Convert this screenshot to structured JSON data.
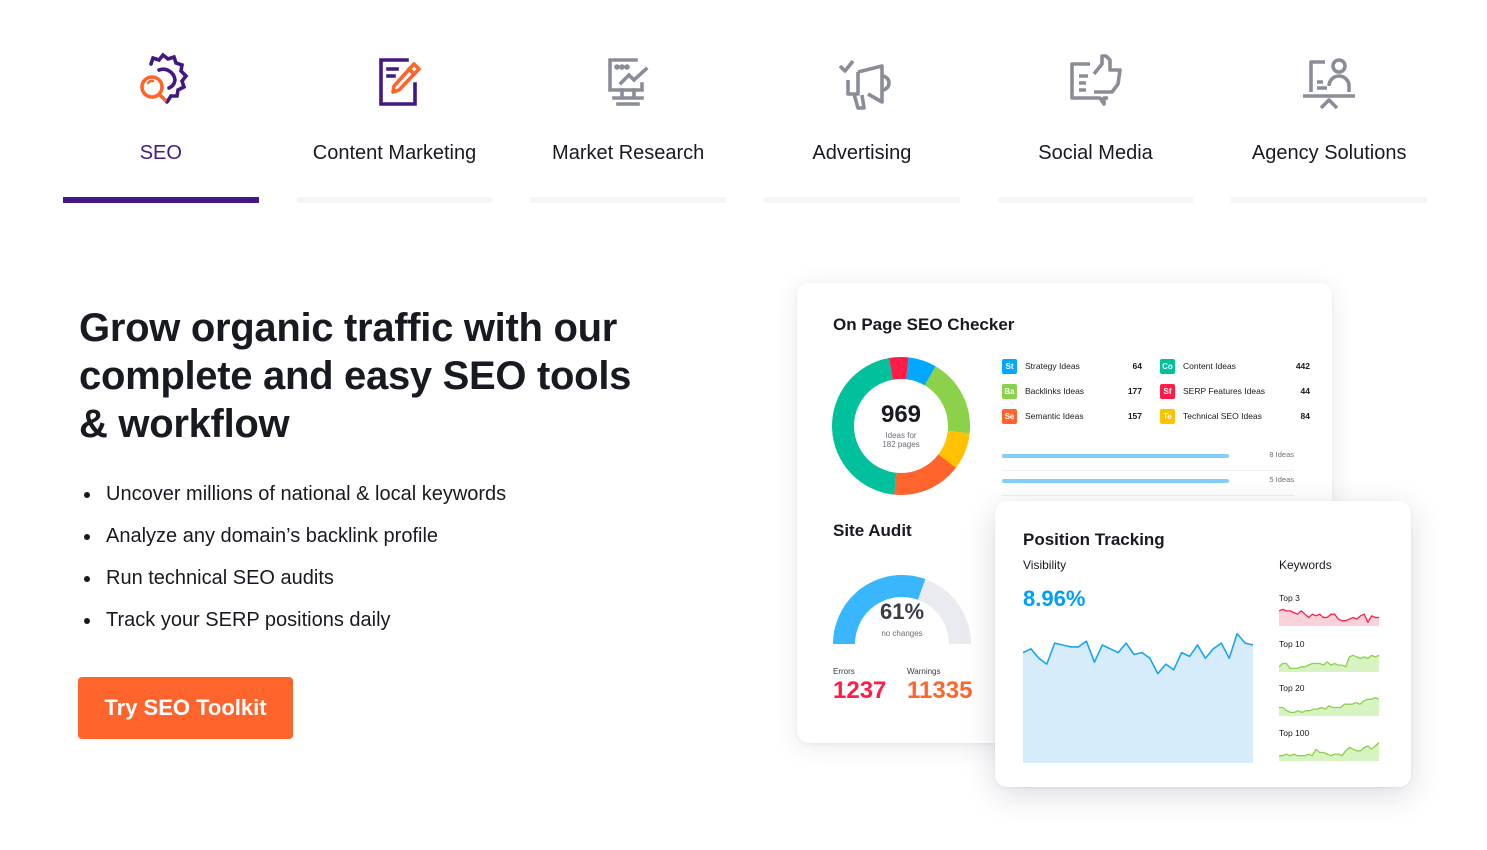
{
  "tabs": [
    {
      "label": "SEO",
      "icon": "seo-gear-magnifier-icon",
      "active": true
    },
    {
      "label": "Content Marketing",
      "icon": "document-pencil-icon",
      "active": false
    },
    {
      "label": "Market Research",
      "icon": "monitor-chart-icon",
      "active": false
    },
    {
      "label": "Advertising",
      "icon": "megaphone-check-icon",
      "active": false
    },
    {
      "label": "Social Media",
      "icon": "thumbs-up-chat-icon",
      "active": false
    },
    {
      "label": "Agency Solutions",
      "icon": "presentation-person-icon",
      "active": false
    }
  ],
  "hero": {
    "headline": "Grow organic traffic with our complete and easy SEO tools & workflow",
    "bullets": [
      "Uncover millions of national & local keywords",
      "Analyze any domain’s backlink profile",
      "Run technical SEO audits",
      "Track your SERP positions daily"
    ],
    "cta_label": "Try SEO Toolkit"
  },
  "colors": {
    "brand_purple": "#421983",
    "cta_orange": "#ff642d",
    "visibility_blue": "#009ff5",
    "error_red": "#ff1d48",
    "warning_orange": "#ff642d"
  },
  "on_page_checker": {
    "title": "On Page SEO Checker",
    "total": "969",
    "total_sub_line1": "Ideas for",
    "total_sub_line2": "182 pages",
    "ideas": [
      {
        "abbr": "St",
        "name": "Strategy Ideas",
        "value": "64",
        "color": "#00a8ff"
      },
      {
        "abbr": "Co",
        "name": "Content Ideas",
        "value": "442",
        "color": "#00c19c"
      },
      {
        "abbr": "Ba",
        "name": "Backlinks Ideas",
        "value": "177",
        "color": "#8bd149"
      },
      {
        "abbr": "Sf",
        "name": "SERP Features Ideas",
        "value": "44",
        "color": "#ff1d48"
      },
      {
        "abbr": "Se",
        "name": "Semantic Ideas",
        "value": "157",
        "color": "#ff642d"
      },
      {
        "abbr": "Te",
        "name": "Technical SEO Ideas",
        "value": "84",
        "color": "#ffc100"
      }
    ],
    "idea_rows": [
      "8 Ideas",
      "5 Ideas"
    ]
  },
  "site_audit": {
    "title": "Site Audit",
    "percent": 61,
    "percent_label": "61%",
    "percent_sub": "no changes",
    "errors_label": "Errors",
    "errors_value": "1237",
    "warnings_label": "Warnings",
    "warnings_value": "11335"
  },
  "position_tracking": {
    "title": "Position Tracking",
    "visibility_label": "Visibility",
    "visibility_value": "8.96%",
    "keywords_label": "Keywords",
    "visibility_series": [
      58,
      60,
      55,
      52,
      63,
      62,
      61,
      61,
      64,
      53,
      62,
      60,
      58,
      63,
      57,
      58,
      55,
      47,
      52,
      49,
      58,
      56,
      62,
      55,
      60,
      63,
      55,
      68,
      63,
      62
    ],
    "keyword_groups": [
      {
        "label": "Top 3",
        "color": "#ff1d48",
        "fill": "#fcd2da",
        "series": [
          8,
          9,
          8,
          8,
          7,
          6,
          8,
          6,
          4,
          6,
          5,
          6,
          4,
          4,
          6,
          6,
          3,
          2,
          2,
          3,
          4,
          3,
          5,
          6,
          1,
          5,
          4,
          4
        ]
      },
      {
        "label": "Top 10",
        "color": "#8bd149",
        "fill": "#d8f3c2",
        "series": [
          2,
          4,
          4,
          1,
          1,
          1,
          2,
          2,
          3,
          4,
          4,
          4,
          3,
          5,
          3,
          4,
          3,
          3,
          2,
          8,
          9,
          8,
          7,
          8,
          7,
          9,
          8,
          9
        ]
      },
      {
        "label": "Top 20",
        "color": "#8bd149",
        "fill": "#d8f3c2",
        "series": [
          4,
          4,
          2,
          1,
          1,
          2,
          1,
          2,
          2,
          3,
          3,
          4,
          3,
          5,
          4,
          4,
          4,
          6,
          6,
          6,
          7,
          6,
          8,
          9,
          9,
          10,
          9
        ]
      },
      {
        "label": "Top 100",
        "color": "#8bd149",
        "fill": "#d8f3c2",
        "series": [
          2,
          2,
          3,
          2,
          3,
          2,
          2,
          2,
          3,
          2,
          6,
          4,
          4,
          3,
          2,
          3,
          3,
          2,
          5,
          7,
          6,
          5,
          5,
          7,
          8,
          6,
          8,
          10
        ]
      }
    ]
  },
  "donut_segments": [
    {
      "name": "Content",
      "value": 442,
      "color": "#00c19c"
    },
    {
      "name": "SERP Features",
      "value": 44,
      "color": "#ff1d48"
    },
    {
      "name": "Strategy",
      "value": 64,
      "color": "#00a8ff"
    },
    {
      "name": "Backlinks",
      "value": 177,
      "color": "#8bd149"
    },
    {
      "name": "Technical SEO",
      "value": 84,
      "color": "#ffc100"
    },
    {
      "name": "Semantic",
      "value": 157,
      "color": "#ff642d"
    }
  ]
}
